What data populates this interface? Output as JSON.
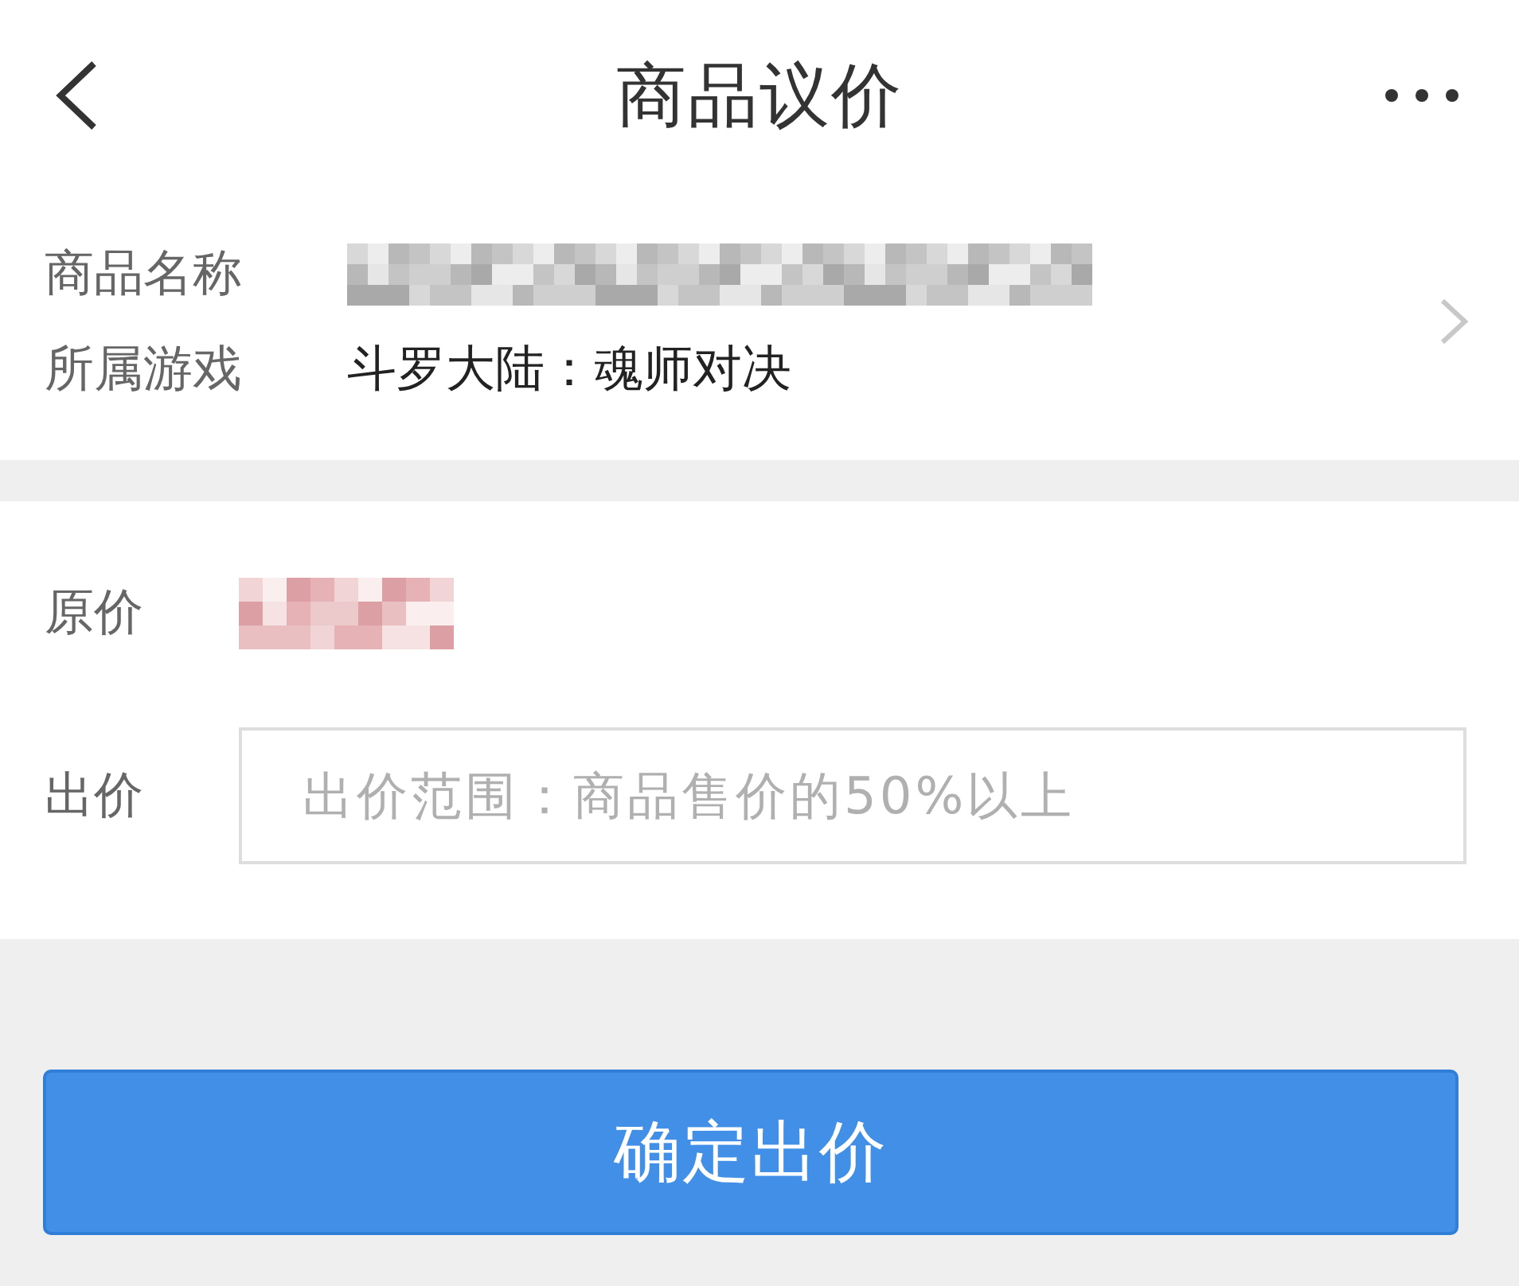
{
  "header": {
    "title": "商品议价"
  },
  "product": {
    "fields": [
      {
        "kind": "obscured",
        "label": "商品名称"
      },
      {
        "kind": "text",
        "label": "所属游戏",
        "value": "斗罗大陆：魂师对决"
      }
    ]
  },
  "price": {
    "rows": [
      {
        "kind": "obscured",
        "label": "原价"
      },
      {
        "kind": "input",
        "label": "出价",
        "placeholder": "出价范围：商品售价的50%以上"
      }
    ]
  },
  "submit_button": {
    "label": "确定出价"
  }
}
